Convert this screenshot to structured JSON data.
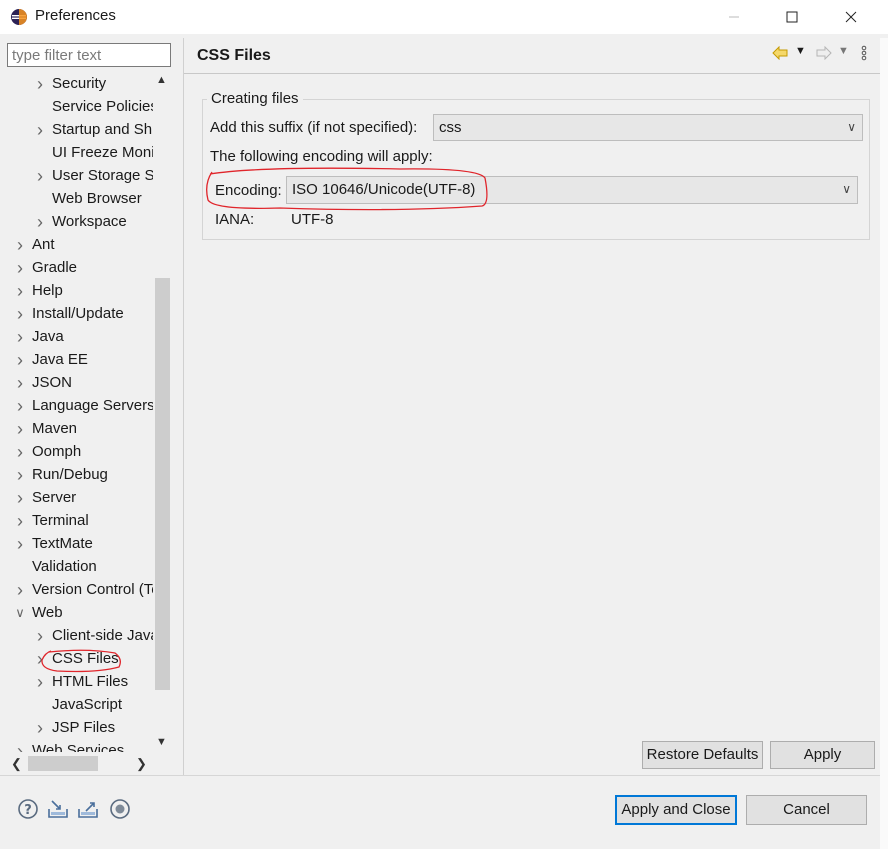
{
  "window": {
    "title": "Preferences"
  },
  "filter": {
    "placeholder": "type filter text"
  },
  "tree": [
    {
      "label": "Security",
      "level": 2,
      "arrow": "collapsed"
    },
    {
      "label": "Service Policies",
      "level": 2,
      "arrow": "none"
    },
    {
      "label": "Startup and Shutdown",
      "level": 2,
      "arrow": "collapsed"
    },
    {
      "label": "UI Freeze Monitoring",
      "level": 2,
      "arrow": "none"
    },
    {
      "label": "User Storage Service",
      "level": 2,
      "arrow": "collapsed"
    },
    {
      "label": "Web Browser",
      "level": 2,
      "arrow": "none"
    },
    {
      "label": "Workspace",
      "level": 2,
      "arrow": "collapsed"
    },
    {
      "label": "Ant",
      "level": 1,
      "arrow": "collapsed"
    },
    {
      "label": "Gradle",
      "level": 1,
      "arrow": "collapsed"
    },
    {
      "label": "Help",
      "level": 1,
      "arrow": "collapsed"
    },
    {
      "label": "Install/Update",
      "level": 1,
      "arrow": "collapsed"
    },
    {
      "label": "Java",
      "level": 1,
      "arrow": "collapsed"
    },
    {
      "label": "Java EE",
      "level": 1,
      "arrow": "collapsed"
    },
    {
      "label": "JSON",
      "level": 1,
      "arrow": "collapsed"
    },
    {
      "label": "Language Servers",
      "level": 1,
      "arrow": "collapsed"
    },
    {
      "label": "Maven",
      "level": 1,
      "arrow": "collapsed"
    },
    {
      "label": "Oomph",
      "level": 1,
      "arrow": "collapsed"
    },
    {
      "label": "Run/Debug",
      "level": 1,
      "arrow": "collapsed"
    },
    {
      "label": "Server",
      "level": 1,
      "arrow": "collapsed"
    },
    {
      "label": "Terminal",
      "level": 1,
      "arrow": "collapsed"
    },
    {
      "label": "TextMate",
      "level": 1,
      "arrow": "collapsed"
    },
    {
      "label": "Validation",
      "level": 1,
      "arrow": "none"
    },
    {
      "label": "Version Control (Team)",
      "level": 1,
      "arrow": "collapsed"
    },
    {
      "label": "Web",
      "level": 1,
      "arrow": "expanded"
    },
    {
      "label": "Client-side JavaScript",
      "level": 2,
      "arrow": "collapsed"
    },
    {
      "label": "CSS Files",
      "level": 2,
      "arrow": "collapsed",
      "selected": true
    },
    {
      "label": "HTML Files",
      "level": 2,
      "arrow": "collapsed"
    },
    {
      "label": "JavaScript",
      "level": 2,
      "arrow": "none"
    },
    {
      "label": "JSP Files",
      "level": 2,
      "arrow": "collapsed"
    },
    {
      "label": "Web Services",
      "level": 1,
      "arrow": "collapsed"
    }
  ],
  "page": {
    "title": "CSS Files",
    "group_label": "Creating files",
    "suffix_label": "Add this suffix (if not specified):",
    "suffix_value": "css",
    "encoding_note": "The following encoding will apply:",
    "encoding_label": "Encoding:",
    "encoding_value": "ISO 10646/Unicode(UTF-8)",
    "iana_label": "IANA:",
    "iana_value": "UTF-8"
  },
  "buttons": {
    "restore_defaults": "Restore Defaults",
    "apply": "Apply",
    "apply_and_close": "Apply and Close",
    "cancel": "Cancel"
  },
  "colors": {
    "annotation": "#e0252b",
    "focus_border": "#0078d7"
  }
}
